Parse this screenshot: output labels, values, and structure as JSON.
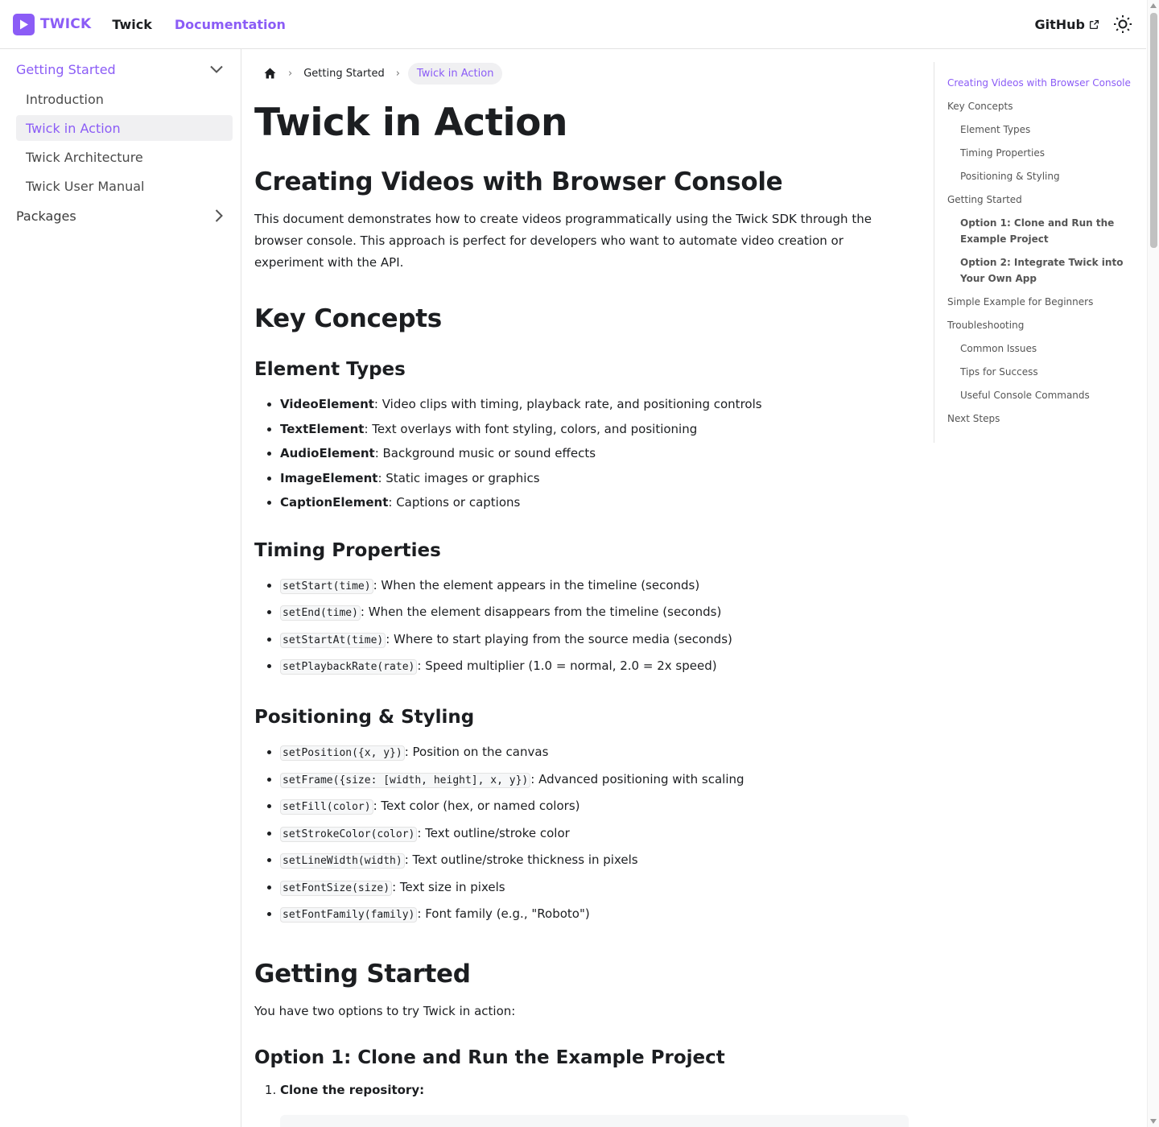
{
  "navbar": {
    "brand": "TWICK",
    "links": [
      "Twick",
      "Documentation"
    ],
    "github": "GitHub"
  },
  "sidebar": {
    "categories": [
      {
        "label": "Getting Started",
        "expanded": true,
        "items": [
          "Introduction",
          "Twick in Action",
          "Twick Architecture",
          "Twick User Manual"
        ],
        "active_item": "Twick in Action"
      },
      {
        "label": "Packages",
        "expanded": false
      }
    ]
  },
  "breadcrumbs": {
    "items": [
      "Getting Started"
    ],
    "current": "Twick in Action"
  },
  "content": {
    "title": "Twick in Action",
    "h_creating": "Creating Videos with Browser Console",
    "intro": "This document demonstrates how to create videos programmatically using the Twick SDK through the browser console. This approach is perfect for developers who want to automate video creation or experiment with the API.",
    "h_key": "Key Concepts",
    "h_element_types": "Element Types",
    "element_types": [
      {
        "name": "VideoElement",
        "desc": ": Video clips with timing, playback rate, and positioning controls"
      },
      {
        "name": "TextElement",
        "desc": ": Text overlays with font styling, colors, and positioning"
      },
      {
        "name": "AudioElement",
        "desc": ": Background music or sound effects"
      },
      {
        "name": "ImageElement",
        "desc": ": Static images or graphics"
      },
      {
        "name": "CaptionElement",
        "desc": ": Captions or captions"
      }
    ],
    "h_timing": "Timing Properties",
    "timing": [
      {
        "code": "setStart(time)",
        "desc": ": When the element appears in the timeline (seconds)"
      },
      {
        "code": "setEnd(time)",
        "desc": ": When the element disappears from the timeline (seconds)"
      },
      {
        "code": "setStartAt(time)",
        "desc": ": Where to start playing from the source media (seconds)"
      },
      {
        "code": "setPlaybackRate(rate)",
        "desc": ": Speed multiplier (1.0 = normal, 2.0 = 2x speed)"
      }
    ],
    "h_positioning": "Positioning & Styling",
    "positioning": [
      {
        "code": "setPosition({x, y})",
        "desc": ": Position on the canvas"
      },
      {
        "code": "setFrame({size: [width, height], x, y})",
        "desc": ": Advanced positioning with scaling"
      },
      {
        "code": "setFill(color)",
        "desc": ": Text color (hex, or named colors)"
      },
      {
        "code": "setStrokeColor(color)",
        "desc": ": Text outline/stroke color"
      },
      {
        "code": "setLineWidth(width)",
        "desc": ": Text outline/stroke thickness in pixels"
      },
      {
        "code": "setFontSize(size)",
        "desc": ": Text size in pixels"
      },
      {
        "code": "setFontFamily(family)",
        "desc": ": Font family (e.g., \"Roboto\")"
      }
    ],
    "h_getting": "Getting Started",
    "getting_text": "You have two options to try Twick in action:",
    "h_option1": "Option 1: Clone and Run the Example Project",
    "steps": [
      "Clone the repository:"
    ]
  },
  "toc": [
    {
      "label": "Creating Videos with Browser Console",
      "level": 1,
      "active": true
    },
    {
      "label": "Key Concepts",
      "level": 1
    },
    {
      "label": "Element Types",
      "level": 2
    },
    {
      "label": "Timing Properties",
      "level": 2
    },
    {
      "label": "Positioning & Styling",
      "level": 2
    },
    {
      "label": "Getting Started",
      "level": 1
    },
    {
      "label": "Option 1: Clone and Run the Example Project",
      "level": 2,
      "bold": true
    },
    {
      "label": "Option 2: Integrate Twick into Your Own App",
      "level": 2,
      "bold": true
    },
    {
      "label": "Simple Example for Beginners",
      "level": 1
    },
    {
      "label": "Troubleshooting",
      "level": 1
    },
    {
      "label": "Common Issues",
      "level": 2
    },
    {
      "label": "Tips for Success",
      "level": 2
    },
    {
      "label": "Useful Console Commands",
      "level": 2
    },
    {
      "label": "Next Steps",
      "level": 1
    }
  ],
  "colors": {
    "accent": "#8b5cf6",
    "text": "#1c1e21",
    "muted": "#555555"
  }
}
